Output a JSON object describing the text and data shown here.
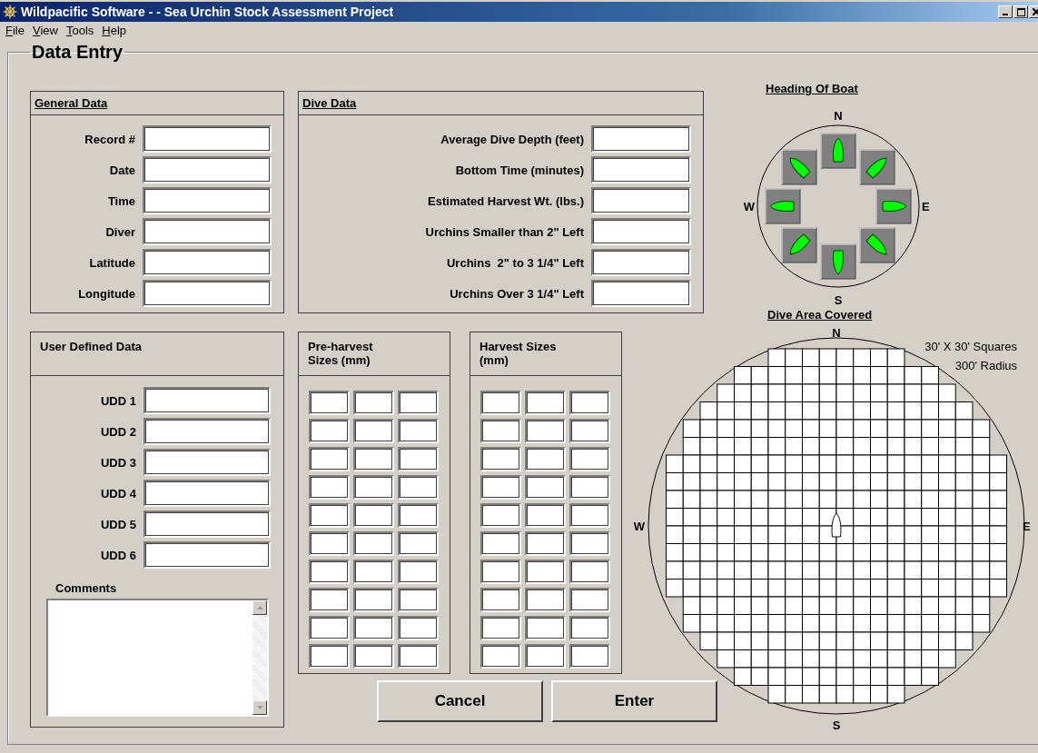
{
  "window": {
    "title": "Wildpacific Software - - Sea Urchin Stock Assessment Project"
  },
  "menu": [
    {
      "label": "File"
    },
    {
      "label": "View"
    },
    {
      "label": "Tools"
    },
    {
      "label": "Help"
    }
  ],
  "group_title": "Data Entry",
  "general_data": {
    "title": "General Data",
    "fields": [
      {
        "label": "Record #"
      },
      {
        "label": "Date"
      },
      {
        "label": "Time"
      },
      {
        "label": "Diver"
      },
      {
        "label": "Latitude"
      },
      {
        "label": "Longitude"
      }
    ]
  },
  "dive_data": {
    "title": "Dive Data",
    "fields": [
      {
        "label": "Average Dive Depth (feet)"
      },
      {
        "label": "Bottom Time (minutes)"
      },
      {
        "label": "Estimated Harvest Wt. (lbs.)"
      },
      {
        "label": "Urchins Smaller than 2\" Left"
      },
      {
        "label": "Urchins  2\" to 3 1/4\" Left"
      },
      {
        "label": "Urchins Over 3 1/4\" Left"
      }
    ]
  },
  "user_defined_data": {
    "title": "User Defined Data",
    "fields": [
      {
        "label": "UDD 1"
      },
      {
        "label": "UDD 2"
      },
      {
        "label": "UDD 3"
      },
      {
        "label": "UDD 4"
      },
      {
        "label": "UDD 5"
      },
      {
        "label": "UDD 6"
      }
    ],
    "comments_label": "Comments"
  },
  "size_panels": [
    {
      "title": "Pre-harvest\nSizes (mm)"
    },
    {
      "title": "Harvest Sizes\n(mm)"
    }
  ],
  "buttons": [
    {
      "label": "Cancel"
    },
    {
      "label": "Enter"
    }
  ],
  "heading_of_boat": {
    "title": "Heading Of Boat",
    "north": "N",
    "west": "W",
    "east": "E",
    "south": "S"
  },
  "dive_area": {
    "title": "Dive Area Covered",
    "north": "N",
    "west": "W",
    "east": "E",
    "south": "S",
    "notes": [
      "30' X 30' Squares",
      "300' Radius"
    ]
  }
}
